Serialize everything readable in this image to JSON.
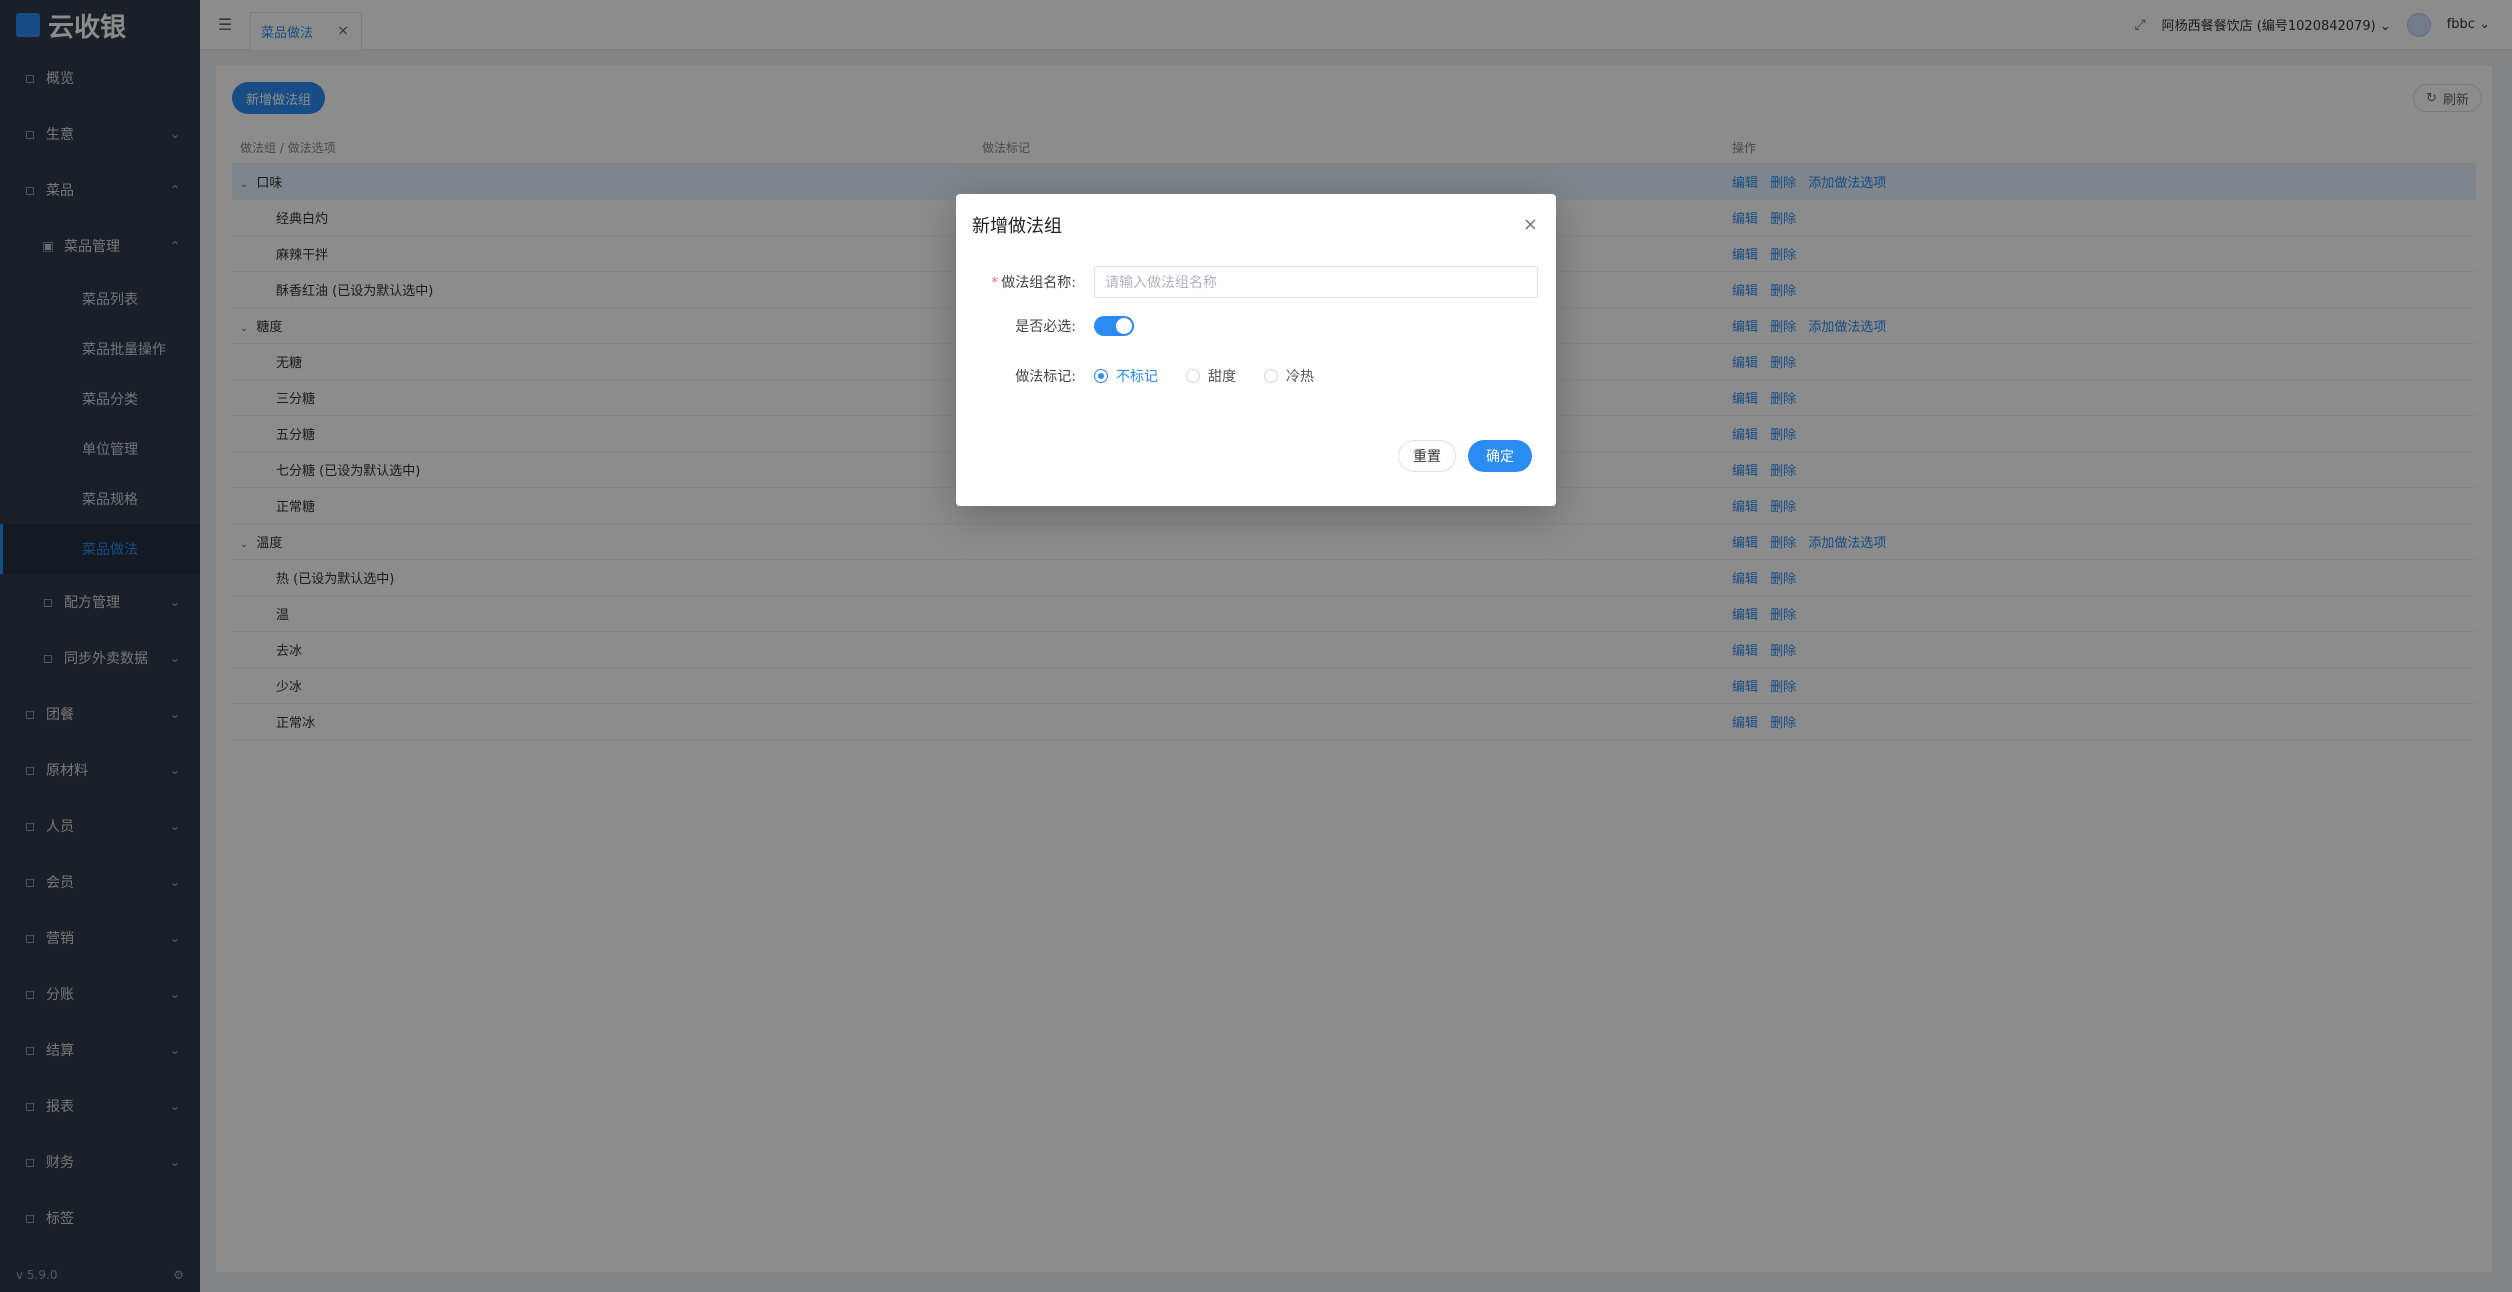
{
  "app": {
    "logo_text": "云收银",
    "version": "v 5.9.0"
  },
  "sidebar": {
    "top": [
      {
        "label": "概览",
        "icon": "grid-icon",
        "chevron": false
      },
      {
        "label": "生意",
        "icon": "store-icon",
        "chevron": true
      },
      {
        "label": "菜品",
        "icon": "dish-icon",
        "chevron": true
      }
    ],
    "dish_management": {
      "label": "菜品管理",
      "icon": "box-icon",
      "chevron": true
    },
    "dish_leaves": [
      "菜品列表",
      "菜品批量操作",
      "菜品分类",
      "单位管理",
      "菜品规格",
      "菜品做法"
    ],
    "middle": [
      {
        "label": "配方管理",
        "icon": "recipe-icon",
        "chevron": true
      },
      {
        "label": "同步外卖数据",
        "icon": "sync-icon",
        "chevron": true
      }
    ],
    "bottom": [
      {
        "label": "团餐",
        "icon": "group-icon",
        "chevron": true
      },
      {
        "label": "原材料",
        "icon": "material-icon",
        "chevron": true
      },
      {
        "label": "人员",
        "icon": "user-icon",
        "chevron": true
      },
      {
        "label": "会员",
        "icon": "member-icon",
        "chevron": true
      },
      {
        "label": "营销",
        "icon": "marketing-icon",
        "chevron": true
      },
      {
        "label": "分账",
        "icon": "split-icon",
        "chevron": true
      },
      {
        "label": "结算",
        "icon": "settle-icon",
        "chevron": true
      },
      {
        "label": "报表",
        "icon": "report-icon",
        "chevron": true
      },
      {
        "label": "财务",
        "icon": "finance-icon",
        "chevron": true
      },
      {
        "label": "标签",
        "icon": "tag-icon",
        "chevron": false
      }
    ]
  },
  "header": {
    "tab_label": "菜品做法",
    "store_label": "阿杨西餐餐饮店 (编号1020842079)",
    "user_name": "fbbc"
  },
  "main": {
    "add_group_button": "新增做法组",
    "refresh_button": "刷新",
    "columns": [
      "做法组 / 做法选项",
      "做法标记",
      "操作"
    ],
    "actions": {
      "edit": "编辑",
      "delete": "删除",
      "add_option": "添加做法选项"
    },
    "groups": [
      {
        "name": "口味",
        "options": [
          "经典白灼",
          "麻辣干拌",
          "酥香红油 (已设为默认选中)"
        ]
      },
      {
        "name": "糖度",
        "options": [
          "无糖",
          "三分糖",
          "五分糖",
          "七分糖 (已设为默认选中)",
          "正常糖"
        ]
      },
      {
        "name": "温度",
        "options": [
          "热 (已设为默认选中)",
          "温",
          "去冰",
          "少冰",
          "正常冰"
        ]
      }
    ]
  },
  "modal": {
    "title": "新增做法组",
    "group_name_label": "做法组名称:",
    "group_name_placeholder": "请输入做法组名称",
    "required_label": "是否必选:",
    "required_on": true,
    "mark_label": "做法标记:",
    "mark_options": [
      "不标记",
      "甜度",
      "冷热"
    ],
    "mark_selected": "不标记",
    "reset_button": "重置",
    "confirm_button": "确定"
  },
  "colors": {
    "accent": "#2a8bf0",
    "sidebar_bg": "#30394a",
    "overlay": "rgba(0,0,0,0.45)"
  }
}
